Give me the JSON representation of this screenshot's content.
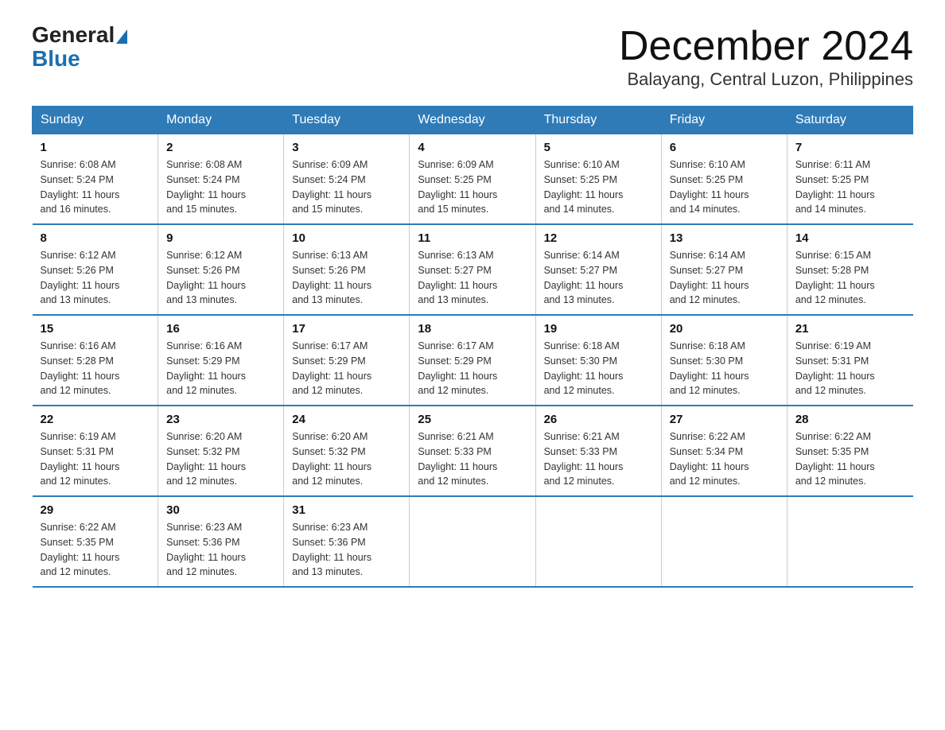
{
  "header": {
    "logo_general": "General",
    "logo_blue": "Blue",
    "month_title": "December 2024",
    "location": "Balayang, Central Luzon, Philippines"
  },
  "weekdays": [
    "Sunday",
    "Monday",
    "Tuesday",
    "Wednesday",
    "Thursday",
    "Friday",
    "Saturday"
  ],
  "weeks": [
    [
      {
        "day": "1",
        "info": "Sunrise: 6:08 AM\nSunset: 5:24 PM\nDaylight: 11 hours\nand 16 minutes."
      },
      {
        "day": "2",
        "info": "Sunrise: 6:08 AM\nSunset: 5:24 PM\nDaylight: 11 hours\nand 15 minutes."
      },
      {
        "day": "3",
        "info": "Sunrise: 6:09 AM\nSunset: 5:24 PM\nDaylight: 11 hours\nand 15 minutes."
      },
      {
        "day": "4",
        "info": "Sunrise: 6:09 AM\nSunset: 5:25 PM\nDaylight: 11 hours\nand 15 minutes."
      },
      {
        "day": "5",
        "info": "Sunrise: 6:10 AM\nSunset: 5:25 PM\nDaylight: 11 hours\nand 14 minutes."
      },
      {
        "day": "6",
        "info": "Sunrise: 6:10 AM\nSunset: 5:25 PM\nDaylight: 11 hours\nand 14 minutes."
      },
      {
        "day": "7",
        "info": "Sunrise: 6:11 AM\nSunset: 5:25 PM\nDaylight: 11 hours\nand 14 minutes."
      }
    ],
    [
      {
        "day": "8",
        "info": "Sunrise: 6:12 AM\nSunset: 5:26 PM\nDaylight: 11 hours\nand 13 minutes."
      },
      {
        "day": "9",
        "info": "Sunrise: 6:12 AM\nSunset: 5:26 PM\nDaylight: 11 hours\nand 13 minutes."
      },
      {
        "day": "10",
        "info": "Sunrise: 6:13 AM\nSunset: 5:26 PM\nDaylight: 11 hours\nand 13 minutes."
      },
      {
        "day": "11",
        "info": "Sunrise: 6:13 AM\nSunset: 5:27 PM\nDaylight: 11 hours\nand 13 minutes."
      },
      {
        "day": "12",
        "info": "Sunrise: 6:14 AM\nSunset: 5:27 PM\nDaylight: 11 hours\nand 13 minutes."
      },
      {
        "day": "13",
        "info": "Sunrise: 6:14 AM\nSunset: 5:27 PM\nDaylight: 11 hours\nand 12 minutes."
      },
      {
        "day": "14",
        "info": "Sunrise: 6:15 AM\nSunset: 5:28 PM\nDaylight: 11 hours\nand 12 minutes."
      }
    ],
    [
      {
        "day": "15",
        "info": "Sunrise: 6:16 AM\nSunset: 5:28 PM\nDaylight: 11 hours\nand 12 minutes."
      },
      {
        "day": "16",
        "info": "Sunrise: 6:16 AM\nSunset: 5:29 PM\nDaylight: 11 hours\nand 12 minutes."
      },
      {
        "day": "17",
        "info": "Sunrise: 6:17 AM\nSunset: 5:29 PM\nDaylight: 11 hours\nand 12 minutes."
      },
      {
        "day": "18",
        "info": "Sunrise: 6:17 AM\nSunset: 5:29 PM\nDaylight: 11 hours\nand 12 minutes."
      },
      {
        "day": "19",
        "info": "Sunrise: 6:18 AM\nSunset: 5:30 PM\nDaylight: 11 hours\nand 12 minutes."
      },
      {
        "day": "20",
        "info": "Sunrise: 6:18 AM\nSunset: 5:30 PM\nDaylight: 11 hours\nand 12 minutes."
      },
      {
        "day": "21",
        "info": "Sunrise: 6:19 AM\nSunset: 5:31 PM\nDaylight: 11 hours\nand 12 minutes."
      }
    ],
    [
      {
        "day": "22",
        "info": "Sunrise: 6:19 AM\nSunset: 5:31 PM\nDaylight: 11 hours\nand 12 minutes."
      },
      {
        "day": "23",
        "info": "Sunrise: 6:20 AM\nSunset: 5:32 PM\nDaylight: 11 hours\nand 12 minutes."
      },
      {
        "day": "24",
        "info": "Sunrise: 6:20 AM\nSunset: 5:32 PM\nDaylight: 11 hours\nand 12 minutes."
      },
      {
        "day": "25",
        "info": "Sunrise: 6:21 AM\nSunset: 5:33 PM\nDaylight: 11 hours\nand 12 minutes."
      },
      {
        "day": "26",
        "info": "Sunrise: 6:21 AM\nSunset: 5:33 PM\nDaylight: 11 hours\nand 12 minutes."
      },
      {
        "day": "27",
        "info": "Sunrise: 6:22 AM\nSunset: 5:34 PM\nDaylight: 11 hours\nand 12 minutes."
      },
      {
        "day": "28",
        "info": "Sunrise: 6:22 AM\nSunset: 5:35 PM\nDaylight: 11 hours\nand 12 minutes."
      }
    ],
    [
      {
        "day": "29",
        "info": "Sunrise: 6:22 AM\nSunset: 5:35 PM\nDaylight: 11 hours\nand 12 minutes."
      },
      {
        "day": "30",
        "info": "Sunrise: 6:23 AM\nSunset: 5:36 PM\nDaylight: 11 hours\nand 12 minutes."
      },
      {
        "day": "31",
        "info": "Sunrise: 6:23 AM\nSunset: 5:36 PM\nDaylight: 11 hours\nand 13 minutes."
      },
      {
        "day": "",
        "info": ""
      },
      {
        "day": "",
        "info": ""
      },
      {
        "day": "",
        "info": ""
      },
      {
        "day": "",
        "info": ""
      }
    ]
  ]
}
